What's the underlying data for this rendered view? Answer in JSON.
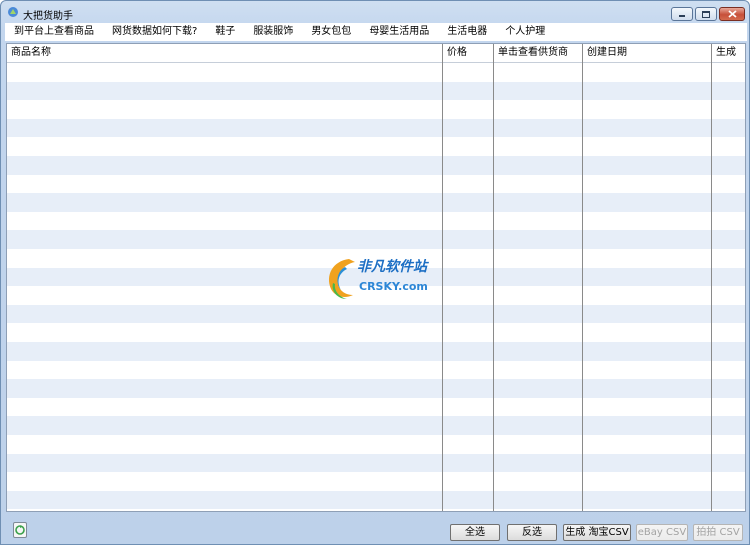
{
  "window": {
    "title": "大把货助手"
  },
  "menu": {
    "items": [
      "到平台上查看商品",
      "网货数据如何下载?",
      "鞋子",
      "服装服饰",
      "男女包包",
      "母婴生活用品",
      "生活电器",
      "个人护理"
    ]
  },
  "table": {
    "columns": [
      "商品名称",
      "价格",
      "单击查看供货商",
      "创建日期",
      "生成"
    ],
    "row_count": 24
  },
  "watermark": {
    "line1": "非凡软件站",
    "line2": "CRSKY.com"
  },
  "buttons": {
    "select_all": "全选",
    "invert": "反选",
    "taobao_csv": "生成 淘宝CSV",
    "ebay_csv": "eBay CSV",
    "paipai_csv": "拍拍 CSV"
  },
  "colors": {
    "row_alt": "#e7eef8",
    "frame": "#c3d6ee"
  }
}
